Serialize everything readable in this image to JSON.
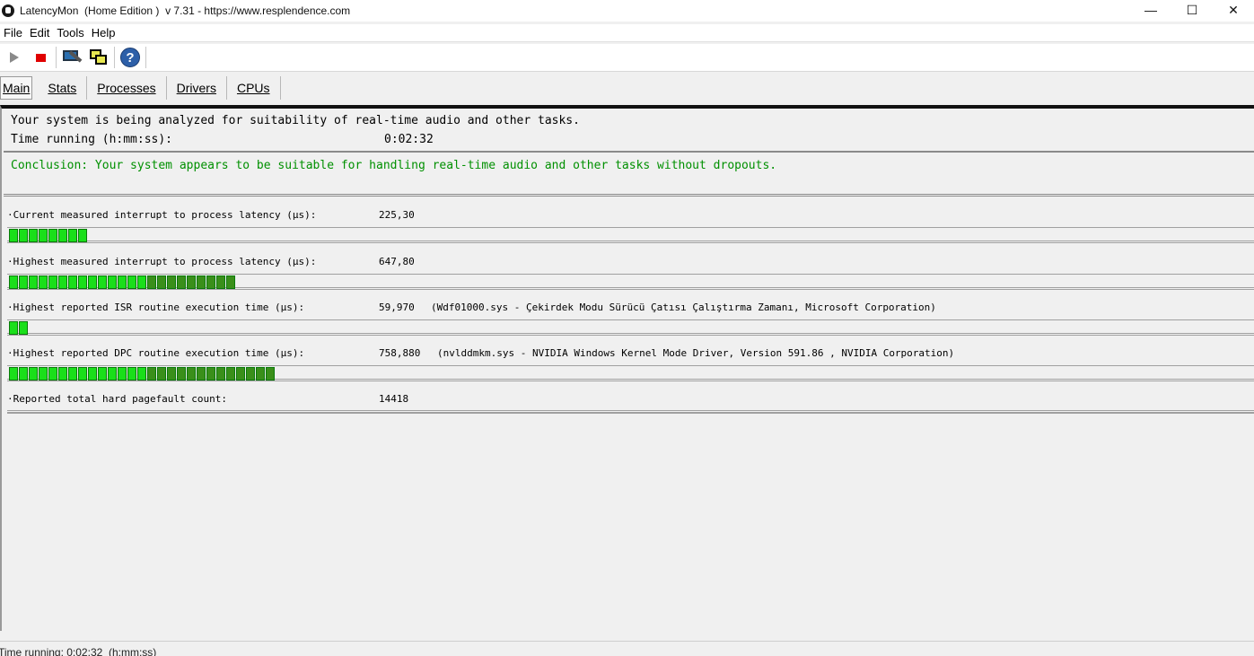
{
  "window": {
    "title": "LatencyMon  (Home Edition )  v 7.31 - https://www.resplendence.com",
    "minimize": "—",
    "maximize": "☐",
    "close": "✕"
  },
  "menu": [
    {
      "label": "File"
    },
    {
      "label": "Edit"
    },
    {
      "label": "Tools"
    },
    {
      "label": "Help"
    }
  ],
  "toolbar": {
    "icons": [
      "play-icon",
      "stop-icon",
      "tools-icon",
      "windows-icon",
      "help-icon"
    ]
  },
  "tabs": [
    {
      "label": "Main",
      "active": true
    },
    {
      "label": "Stats"
    },
    {
      "label": "Processes"
    },
    {
      "label": "Drivers"
    },
    {
      "label": "CPUs"
    }
  ],
  "main": {
    "analysis_text": "Your system is being analyzed for suitability of real-time audio and other tasks.",
    "time_running_label": "Time running (h:mm:ss):",
    "time_running_value": "0:02:32",
    "conclusion": "Conclusion: Your system appears to be suitable for handling real-time audio and other tasks without dropouts.",
    "conclusion_color": "#009000"
  },
  "metrics": [
    {
      "label": "·Current measured interrupt to process latency (µs):",
      "value": "225,30",
      "extra": "",
      "bar_segments": 8
    },
    {
      "label": "·Highest measured interrupt to process latency (µs):",
      "value": "647,80",
      "extra": "",
      "bar_segments": 23
    },
    {
      "label": "·Highest reported ISR routine execution time (µs):",
      "value": "59,970",
      "extra": "(Wdf01000.sys - Çekirdek Modu Sürücü Çatısı Çalıştırma Zamanı, Microsoft Corporation)",
      "bar_segments": 2
    },
    {
      "label": "·Highest reported DPC routine execution time (µs):",
      "value": "758,880",
      "extra": "(nvlddmkm.sys - NVIDIA Windows Kernel Mode Driver, Version 591.86 , NVIDIA Corporation)",
      "bar_segments": 27
    },
    {
      "label": "·Reported total hard pagefault count:",
      "value": "14418",
      "extra": ""
    }
  ],
  "colors": {
    "bar_bright": "#1adf1a",
    "bar_dark": "#3a8f1a"
  },
  "statusbar": {
    "text": "Time running: 0:02:32  (h:mm:ss)"
  }
}
